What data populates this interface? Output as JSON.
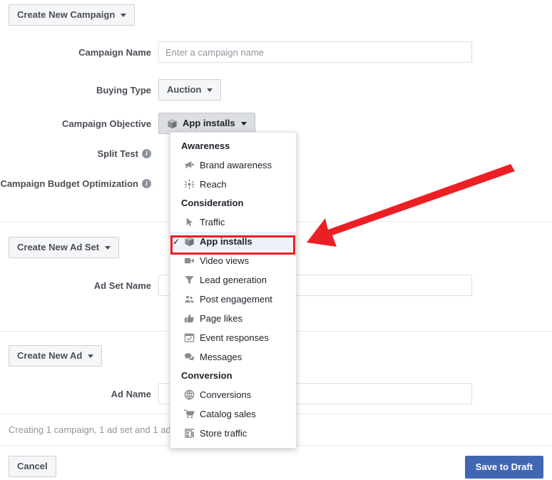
{
  "app": {
    "title": "Create New Campaign"
  },
  "toolbar": {
    "create_campaign_label": "Create New Campaign",
    "create_adset_label": "Create New Ad Set",
    "create_ad_label": "Create New Ad"
  },
  "campaign": {
    "name_label": "Campaign Name",
    "name_value": "",
    "name_placeholder": "Enter a campaign name",
    "buying_type_label": "Buying Type",
    "buying_type_value": "Auction",
    "objective_label": "Campaign Objective",
    "objective_value": "App installs",
    "split_test_label": "Split Test",
    "split_test_info": "i",
    "budget_optimization_label": "Campaign Budget Optimization",
    "budget_optimization_info": "i"
  },
  "adset": {
    "name_label": "Ad Set Name",
    "name_value": "",
    "name_placeholder": ""
  },
  "ad": {
    "name_label": "Ad Name",
    "name_value": "",
    "name_placeholder": ""
  },
  "footer": {
    "status_text": "Creating 1 campaign, 1 ad set and 1 ad",
    "cancel_label": "Cancel",
    "save_label": "Save to Draft"
  },
  "objective_dropdown": {
    "selected": "App installs",
    "groups": [
      {
        "title": "Awareness",
        "items": [
          {
            "label": "Brand awareness",
            "icon": "megaphone-icon"
          },
          {
            "label": "Reach",
            "icon": "starburst-icon"
          }
        ]
      },
      {
        "title": "Consideration",
        "items": [
          {
            "label": "Traffic",
            "icon": "cursor-icon"
          },
          {
            "label": "App installs",
            "icon": "box-icon"
          },
          {
            "label": "Video views",
            "icon": "video-camera-icon"
          },
          {
            "label": "Lead generation",
            "icon": "funnel-icon"
          },
          {
            "label": "Post engagement",
            "icon": "people-icon"
          },
          {
            "label": "Page likes",
            "icon": "thumbs-up-icon"
          },
          {
            "label": "Event responses",
            "icon": "calendar-check-icon"
          },
          {
            "label": "Messages",
            "icon": "chat-bubbles-icon"
          }
        ]
      },
      {
        "title": "Conversion",
        "items": [
          {
            "label": "Conversions",
            "icon": "globe-icon"
          },
          {
            "label": "Catalog sales",
            "icon": "shopping-cart-icon"
          },
          {
            "label": "Store traffic",
            "icon": "storefront-icon"
          }
        ]
      }
    ],
    "check_glyph": "✓"
  },
  "annotations": {
    "highlight_color": "#ec2024",
    "arrow_color": "#ec2024"
  },
  "colors": {
    "primary_button": "#4267b2",
    "selected_row": "#edf2fa",
    "label_text": "#4b4f56"
  }
}
